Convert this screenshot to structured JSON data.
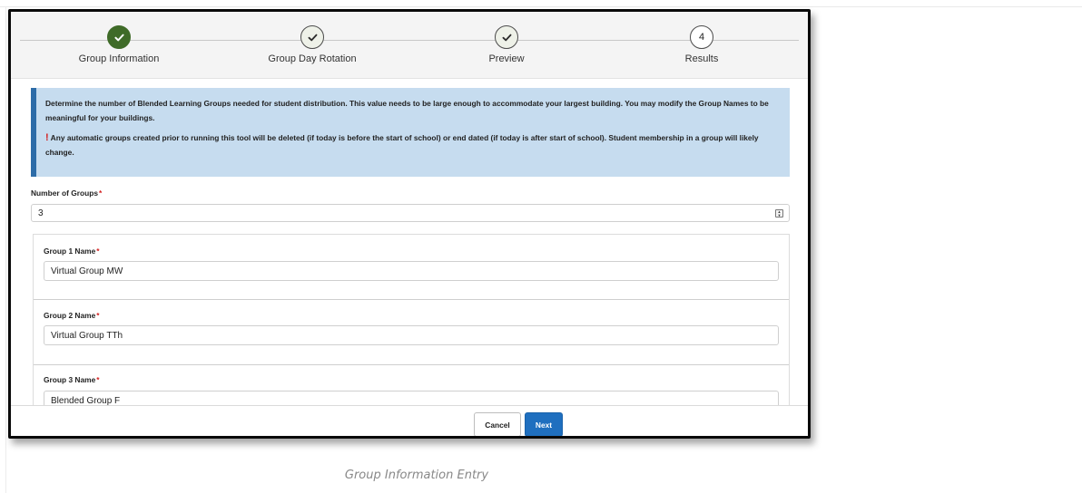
{
  "stepper": {
    "steps": [
      {
        "label": "Group Information",
        "state": "active",
        "icon": "check-icon"
      },
      {
        "label": "Group Day Rotation",
        "state": "done",
        "icon": "check-icon"
      },
      {
        "label": "Preview",
        "state": "done",
        "icon": "check-icon"
      },
      {
        "label": "Results",
        "state": "todo",
        "number": "4"
      }
    ]
  },
  "info": {
    "paragraph1": "Determine the number of Blended Learning Groups needed for student distribution. This value needs to be large enough to accommodate your largest building. You may modify the Group Names to be meaningful for your buildings.",
    "warning_icon": "!",
    "paragraph2": "Any automatic groups created prior to running this tool will be deleted (if today is before the start of school) or end dated (if today is after start of school). Student membership in a group will likely change."
  },
  "number_of_groups": {
    "label": "Number of Groups",
    "required_mark": "*",
    "value": "3"
  },
  "groups": [
    {
      "label": "Group 1 Name",
      "required_mark": "*",
      "value": "Virtual Group MW"
    },
    {
      "label": "Group 2 Name",
      "required_mark": "*",
      "value": "Virtual Group TTh"
    },
    {
      "label": "Group 3 Name",
      "required_mark": "*",
      "value": "Blended Group F"
    }
  ],
  "footer": {
    "cancel_label": "Cancel",
    "next_label": "Next"
  },
  "caption": "Group Information Entry",
  "colors": {
    "active_step": "#3f6b28",
    "info_background": "#c6dcef",
    "info_accent": "#2d6ca8",
    "primary_button": "#1f6fbf",
    "required": "#d32020"
  }
}
